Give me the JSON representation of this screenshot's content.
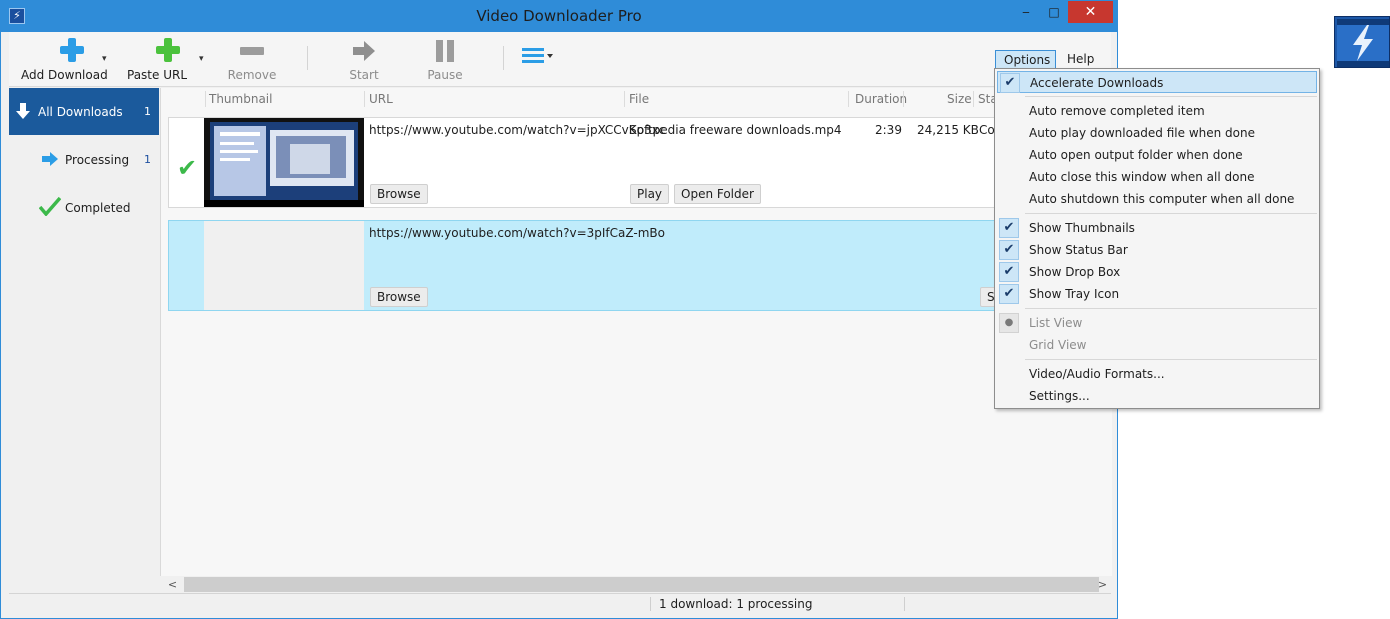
{
  "window": {
    "title": "Video Downloader Pro",
    "min_glyph": "‒",
    "max_glyph": "□",
    "close_glyph": "✕"
  },
  "toolbar": {
    "add_download": "Add Download",
    "paste_url": "Paste URL",
    "remove": "Remove",
    "start": "Start",
    "pause": "Pause",
    "dropdown_glyph": "▾"
  },
  "menubar": {
    "options": "Options ▾",
    "help": "Help ▾"
  },
  "sidebar": {
    "items": [
      {
        "label": "All Downloads",
        "count": "1",
        "icon": "down-arrow-icon"
      },
      {
        "label": "Processing",
        "count": "1",
        "icon": "right-arrow-icon"
      },
      {
        "label": "Completed",
        "count": "",
        "icon": "checkmark-icon"
      }
    ]
  },
  "columns": {
    "thumbnail": "Thumbnail",
    "url": "URL",
    "file": "File",
    "duration": "Duration",
    "size": "Size",
    "status": "Sta"
  },
  "downloads": [
    {
      "url": "https://www.youtube.com/watch?v=jpXCCvKp3xc",
      "file": "Softpedia freeware downloads.mp4",
      "duration": "2:39",
      "size": "24,215 KB",
      "status": "Con",
      "browse": "Browse",
      "play": "Play",
      "open_folder": "Open Folder",
      "check_glyph": "✔"
    },
    {
      "url": "https://www.youtube.com/watch?v=3pIfCaZ-mBo",
      "browse": "Browse",
      "status_btn": "St"
    }
  ],
  "statusbar": {
    "text": "1 download: 1 processing"
  },
  "scrollbar": {
    "left_glyph": "<",
    "right_glyph": ">"
  },
  "options_menu": {
    "check_glyph": "✔",
    "bullet_glyph": "●",
    "items": [
      {
        "label": "Accelerate Downloads",
        "checked": true
      },
      {
        "label": "Auto remove completed item",
        "checked": false
      },
      {
        "label": "Auto play downloaded file when done",
        "checked": false
      },
      {
        "label": "Auto open output folder when done",
        "checked": false
      },
      {
        "label": "Auto close this window when all done",
        "checked": false
      },
      {
        "label": "Auto shutdown this computer when all done",
        "checked": false
      },
      {
        "label": "Show Thumbnails",
        "checked": true
      },
      {
        "label": "Show Status Bar",
        "checked": true
      },
      {
        "label": "Show Drop Box",
        "checked": true
      },
      {
        "label": "Show Tray Icon",
        "checked": true
      },
      {
        "label": "List View",
        "radio": true,
        "disabled": true
      },
      {
        "label": "Grid View",
        "disabled": true
      },
      {
        "label": "Video/Audio Formats...",
        "checked": false
      },
      {
        "label": "Settings...",
        "checked": false
      }
    ]
  },
  "colors": {
    "accent": "#2f8cd8",
    "sidebar_active": "#1b5a9c",
    "selected_row": "#c0ecfb",
    "close_red": "#c7372f",
    "green_check": "#3cb94a"
  }
}
